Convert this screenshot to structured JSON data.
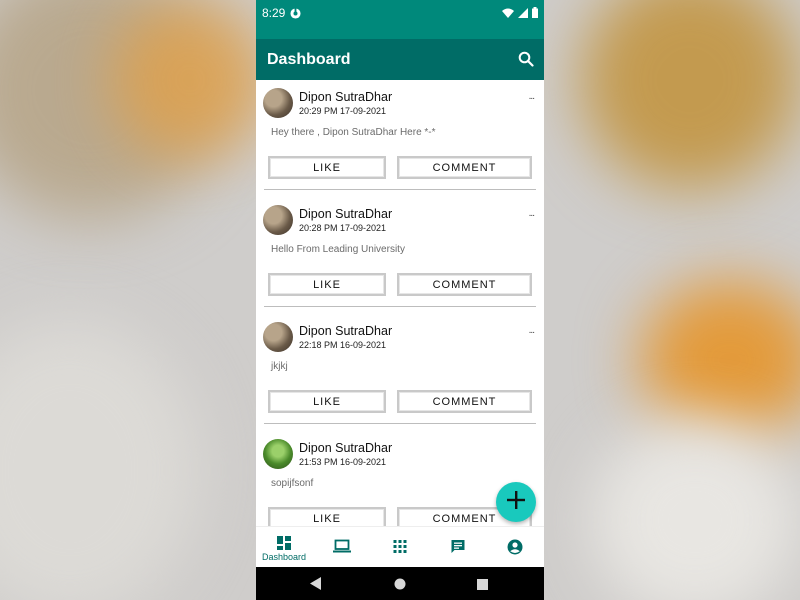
{
  "status_bar": {
    "time": "8:29"
  },
  "app_bar": {
    "title": "Dashboard",
    "search_icon": "search-icon"
  },
  "posts": [
    {
      "author": "Dipon SutraDhar",
      "time": "20:29 PM 17-09-2021",
      "content": "Hey there , Dipon SutraDhar Here *-*",
      "more": "...",
      "like": "LIKE",
      "comment": "COMMENT"
    },
    {
      "author": "Dipon SutraDhar",
      "time": "20:28 PM 17-09-2021",
      "content": "Hello From Leading University",
      "more": "...",
      "like": "LIKE",
      "comment": "COMMENT"
    },
    {
      "author": "Dipon SutraDhar",
      "time": "22:18 PM 16-09-2021",
      "content": "jkjkj",
      "more": "...",
      "like": "LIKE",
      "comment": "COMMENT"
    },
    {
      "author": "Dipon SutraDhar",
      "time": "21:53 PM 16-09-2021",
      "content": "sopijfsonf",
      "more": "",
      "like": "LIKE",
      "comment": "COMMENT"
    }
  ],
  "fab": {
    "icon": "plus-icon"
  },
  "bottom_nav": [
    {
      "label": "Dashboard",
      "icon": "dashboard-icon",
      "active": true
    },
    {
      "label": "",
      "icon": "laptop-icon"
    },
    {
      "label": "",
      "icon": "apps-grid-icon"
    },
    {
      "label": "",
      "icon": "chat-icon"
    },
    {
      "label": "",
      "icon": "account-icon"
    }
  ],
  "colors": {
    "status_bar": "#00897b",
    "app_bar": "#006c66",
    "fab": "#19c9bd",
    "nav_icon": "#006c66"
  }
}
